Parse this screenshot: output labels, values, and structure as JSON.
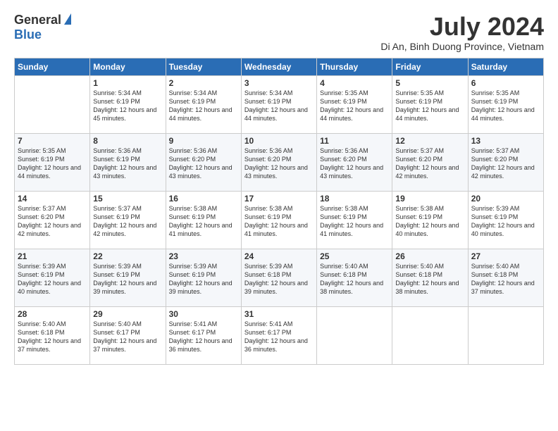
{
  "logo": {
    "general": "General",
    "blue": "Blue"
  },
  "header": {
    "month": "July 2024",
    "location": "Di An, Binh Duong Province, Vietnam"
  },
  "days_of_week": [
    "Sunday",
    "Monday",
    "Tuesday",
    "Wednesday",
    "Thursday",
    "Friday",
    "Saturday"
  ],
  "weeks": [
    [
      {
        "day": "",
        "sunrise": "",
        "sunset": "",
        "daylight": ""
      },
      {
        "day": "1",
        "sunrise": "Sunrise: 5:34 AM",
        "sunset": "Sunset: 6:19 PM",
        "daylight": "Daylight: 12 hours and 45 minutes."
      },
      {
        "day": "2",
        "sunrise": "Sunrise: 5:34 AM",
        "sunset": "Sunset: 6:19 PM",
        "daylight": "Daylight: 12 hours and 44 minutes."
      },
      {
        "day": "3",
        "sunrise": "Sunrise: 5:34 AM",
        "sunset": "Sunset: 6:19 PM",
        "daylight": "Daylight: 12 hours and 44 minutes."
      },
      {
        "day": "4",
        "sunrise": "Sunrise: 5:35 AM",
        "sunset": "Sunset: 6:19 PM",
        "daylight": "Daylight: 12 hours and 44 minutes."
      },
      {
        "day": "5",
        "sunrise": "Sunrise: 5:35 AM",
        "sunset": "Sunset: 6:19 PM",
        "daylight": "Daylight: 12 hours and 44 minutes."
      },
      {
        "day": "6",
        "sunrise": "Sunrise: 5:35 AM",
        "sunset": "Sunset: 6:19 PM",
        "daylight": "Daylight: 12 hours and 44 minutes."
      }
    ],
    [
      {
        "day": "7",
        "sunrise": "Sunrise: 5:35 AM",
        "sunset": "Sunset: 6:19 PM",
        "daylight": "Daylight: 12 hours and 44 minutes."
      },
      {
        "day": "8",
        "sunrise": "Sunrise: 5:36 AM",
        "sunset": "Sunset: 6:19 PM",
        "daylight": "Daylight: 12 hours and 43 minutes."
      },
      {
        "day": "9",
        "sunrise": "Sunrise: 5:36 AM",
        "sunset": "Sunset: 6:20 PM",
        "daylight": "Daylight: 12 hours and 43 minutes."
      },
      {
        "day": "10",
        "sunrise": "Sunrise: 5:36 AM",
        "sunset": "Sunset: 6:20 PM",
        "daylight": "Daylight: 12 hours and 43 minutes."
      },
      {
        "day": "11",
        "sunrise": "Sunrise: 5:36 AM",
        "sunset": "Sunset: 6:20 PM",
        "daylight": "Daylight: 12 hours and 43 minutes."
      },
      {
        "day": "12",
        "sunrise": "Sunrise: 5:37 AM",
        "sunset": "Sunset: 6:20 PM",
        "daylight": "Daylight: 12 hours and 42 minutes."
      },
      {
        "day": "13",
        "sunrise": "Sunrise: 5:37 AM",
        "sunset": "Sunset: 6:20 PM",
        "daylight": "Daylight: 12 hours and 42 minutes."
      }
    ],
    [
      {
        "day": "14",
        "sunrise": "Sunrise: 5:37 AM",
        "sunset": "Sunset: 6:20 PM",
        "daylight": "Daylight: 12 hours and 42 minutes."
      },
      {
        "day": "15",
        "sunrise": "Sunrise: 5:37 AM",
        "sunset": "Sunset: 6:19 PM",
        "daylight": "Daylight: 12 hours and 42 minutes."
      },
      {
        "day": "16",
        "sunrise": "Sunrise: 5:38 AM",
        "sunset": "Sunset: 6:19 PM",
        "daylight": "Daylight: 12 hours and 41 minutes."
      },
      {
        "day": "17",
        "sunrise": "Sunrise: 5:38 AM",
        "sunset": "Sunset: 6:19 PM",
        "daylight": "Daylight: 12 hours and 41 minutes."
      },
      {
        "day": "18",
        "sunrise": "Sunrise: 5:38 AM",
        "sunset": "Sunset: 6:19 PM",
        "daylight": "Daylight: 12 hours and 41 minutes."
      },
      {
        "day": "19",
        "sunrise": "Sunrise: 5:38 AM",
        "sunset": "Sunset: 6:19 PM",
        "daylight": "Daylight: 12 hours and 40 minutes."
      },
      {
        "day": "20",
        "sunrise": "Sunrise: 5:39 AM",
        "sunset": "Sunset: 6:19 PM",
        "daylight": "Daylight: 12 hours and 40 minutes."
      }
    ],
    [
      {
        "day": "21",
        "sunrise": "Sunrise: 5:39 AM",
        "sunset": "Sunset: 6:19 PM",
        "daylight": "Daylight: 12 hours and 40 minutes."
      },
      {
        "day": "22",
        "sunrise": "Sunrise: 5:39 AM",
        "sunset": "Sunset: 6:19 PM",
        "daylight": "Daylight: 12 hours and 39 minutes."
      },
      {
        "day": "23",
        "sunrise": "Sunrise: 5:39 AM",
        "sunset": "Sunset: 6:19 PM",
        "daylight": "Daylight: 12 hours and 39 minutes."
      },
      {
        "day": "24",
        "sunrise": "Sunrise: 5:39 AM",
        "sunset": "Sunset: 6:18 PM",
        "daylight": "Daylight: 12 hours and 39 minutes."
      },
      {
        "day": "25",
        "sunrise": "Sunrise: 5:40 AM",
        "sunset": "Sunset: 6:18 PM",
        "daylight": "Daylight: 12 hours and 38 minutes."
      },
      {
        "day": "26",
        "sunrise": "Sunrise: 5:40 AM",
        "sunset": "Sunset: 6:18 PM",
        "daylight": "Daylight: 12 hours and 38 minutes."
      },
      {
        "day": "27",
        "sunrise": "Sunrise: 5:40 AM",
        "sunset": "Sunset: 6:18 PM",
        "daylight": "Daylight: 12 hours and 37 minutes."
      }
    ],
    [
      {
        "day": "28",
        "sunrise": "Sunrise: 5:40 AM",
        "sunset": "Sunset: 6:18 PM",
        "daylight": "Daylight: 12 hours and 37 minutes."
      },
      {
        "day": "29",
        "sunrise": "Sunrise: 5:40 AM",
        "sunset": "Sunset: 6:17 PM",
        "daylight": "Daylight: 12 hours and 37 minutes."
      },
      {
        "day": "30",
        "sunrise": "Sunrise: 5:41 AM",
        "sunset": "Sunset: 6:17 PM",
        "daylight": "Daylight: 12 hours and 36 minutes."
      },
      {
        "day": "31",
        "sunrise": "Sunrise: 5:41 AM",
        "sunset": "Sunset: 6:17 PM",
        "daylight": "Daylight: 12 hours and 36 minutes."
      },
      {
        "day": "",
        "sunrise": "",
        "sunset": "",
        "daylight": ""
      },
      {
        "day": "",
        "sunrise": "",
        "sunset": "",
        "daylight": ""
      },
      {
        "day": "",
        "sunrise": "",
        "sunset": "",
        "daylight": ""
      }
    ]
  ]
}
